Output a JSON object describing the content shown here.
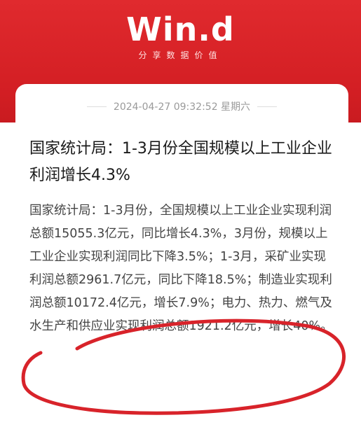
{
  "brand": {
    "logo_text": "Win.d",
    "slogan": "分享数据价值",
    "accent_color": "#d41f24"
  },
  "article": {
    "timestamp": "2024-04-27 09:32:52 星期六",
    "title": "国家统计局：1-3月份全国规模以上工业企业利润增长4.3%",
    "body": "国家统计局：1-3月份，全国规模以上工业企业实现利润总额15055.3亿元，同比增长4.3%，3月份，规模以上工业企业实现利润同比下降3.5%；1-3月，采矿业实现利润总额2961.7亿元，同比下降18.5%；制造业实现利润总额10172.4亿元，增长7.9%；电力、热力、燃气及水生产和供应业实现利润总额1921.2亿元，增长40%。"
  },
  "markup": {
    "ink_color": "#d8232a",
    "shape": "hand-drawn ellipse"
  }
}
